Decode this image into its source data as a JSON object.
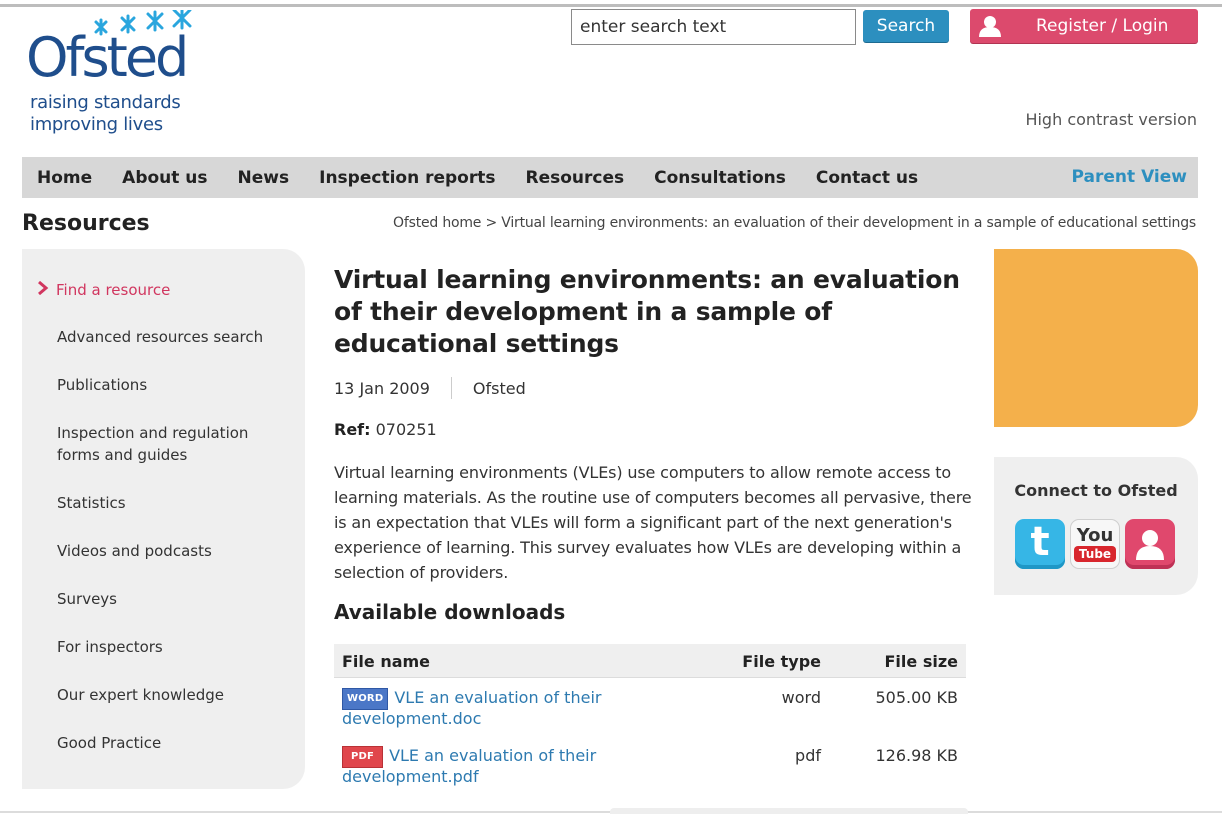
{
  "colors": {
    "brand_blue": "#1f4e8c",
    "search_button": "#2c8fbf",
    "register_button": "#dc4a6d",
    "nav_background": "#d7d7d7",
    "parent_view": "#2d8fbf",
    "active_link": "#d1365f",
    "link": "#2d7ab0",
    "promo_orange": "#f4b04b",
    "panel_grey": "#efefef"
  },
  "header": {
    "logo": {
      "wordmark": "Ofsted",
      "tagline_1": "raising standards",
      "tagline_2": "improving lives"
    },
    "search": {
      "placeholder": "enter search text",
      "button_label": "Search"
    },
    "register_label": "Register / Login",
    "high_contrast_label": "High contrast version"
  },
  "nav": {
    "items": [
      "Home",
      "About us",
      "News",
      "Inspection reports",
      "Resources",
      "Consultations",
      "Contact us"
    ],
    "parent_view": "Parent View"
  },
  "page": {
    "section_title": "Resources",
    "breadcrumb": "Ofsted home > Virtual learning environments: an evaluation of their development in a sample of educational settings"
  },
  "sidebar": {
    "items": [
      {
        "label": "Find a resource",
        "active": true
      },
      {
        "label": "Advanced resources search"
      },
      {
        "label": "Publications"
      },
      {
        "label": "Inspection and regulation forms and guides"
      },
      {
        "label": "Statistics"
      },
      {
        "label": "Videos and podcasts"
      },
      {
        "label": "Surveys"
      },
      {
        "label": "For inspectors"
      },
      {
        "label": "Our expert knowledge"
      },
      {
        "label": "Good Practice"
      }
    ]
  },
  "article": {
    "title": "Virtual learning environments: an evaluation of their development in a sample of educational settings",
    "date": "13 Jan 2009",
    "author": "Ofsted",
    "ref_label": "Ref:",
    "ref_value": "070251",
    "description": "Virtual learning environments (VLEs) use computers to allow remote access to learning materials. As the routine use of computers becomes all pervasive, there is an expectation that VLEs will form a significant part of the next generation's experience of learning. This survey evaluates how VLEs are developing within a selection of providers.",
    "downloads_heading": "Available downloads",
    "table": {
      "headers": {
        "name": "File name",
        "type": "File type",
        "size": "File size"
      },
      "rows": [
        {
          "badge": "WORD",
          "name": "VLE an evaluation of their development.doc",
          "type": "word",
          "size": "505.00 KB"
        },
        {
          "badge": "PDF",
          "name": "VLE an evaluation of their development.pdf",
          "type": "pdf",
          "size": "126.98 KB"
        }
      ]
    }
  },
  "connect": {
    "title": "Connect to Ofsted",
    "icons": [
      "twitter-icon",
      "youtube-icon",
      "ofsted-user-icon"
    ],
    "youtube_you": "You",
    "youtube_tube": "Tube"
  }
}
